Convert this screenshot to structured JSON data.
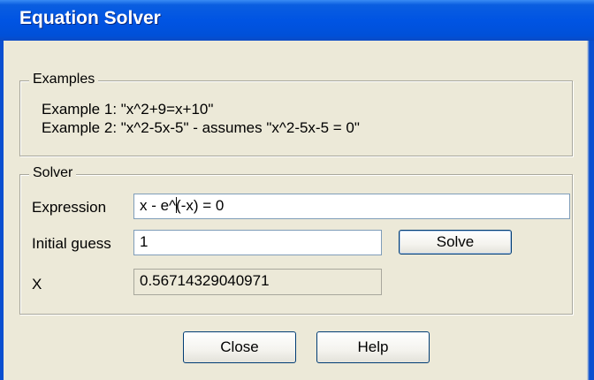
{
  "window": {
    "title": "Equation Solver"
  },
  "examples": {
    "legend": "Examples",
    "line1": "Example 1: \"x^2+9=x+10\"",
    "line2": "Example 2: \"x^2-5x-5\" - assumes \"x^2-5x-5 = 0\""
  },
  "solver": {
    "legend": "Solver",
    "expression_label": "Expression",
    "expression_before_caret": "x - e^",
    "expression_after_caret": "(-x) = 0",
    "initial_guess_label": "Initial guess",
    "initial_guess_value": "1",
    "solve_label": "Solve",
    "x_label": "X",
    "x_value": "0.56714329040971"
  },
  "buttons": {
    "close": "Close",
    "help": "Help"
  }
}
